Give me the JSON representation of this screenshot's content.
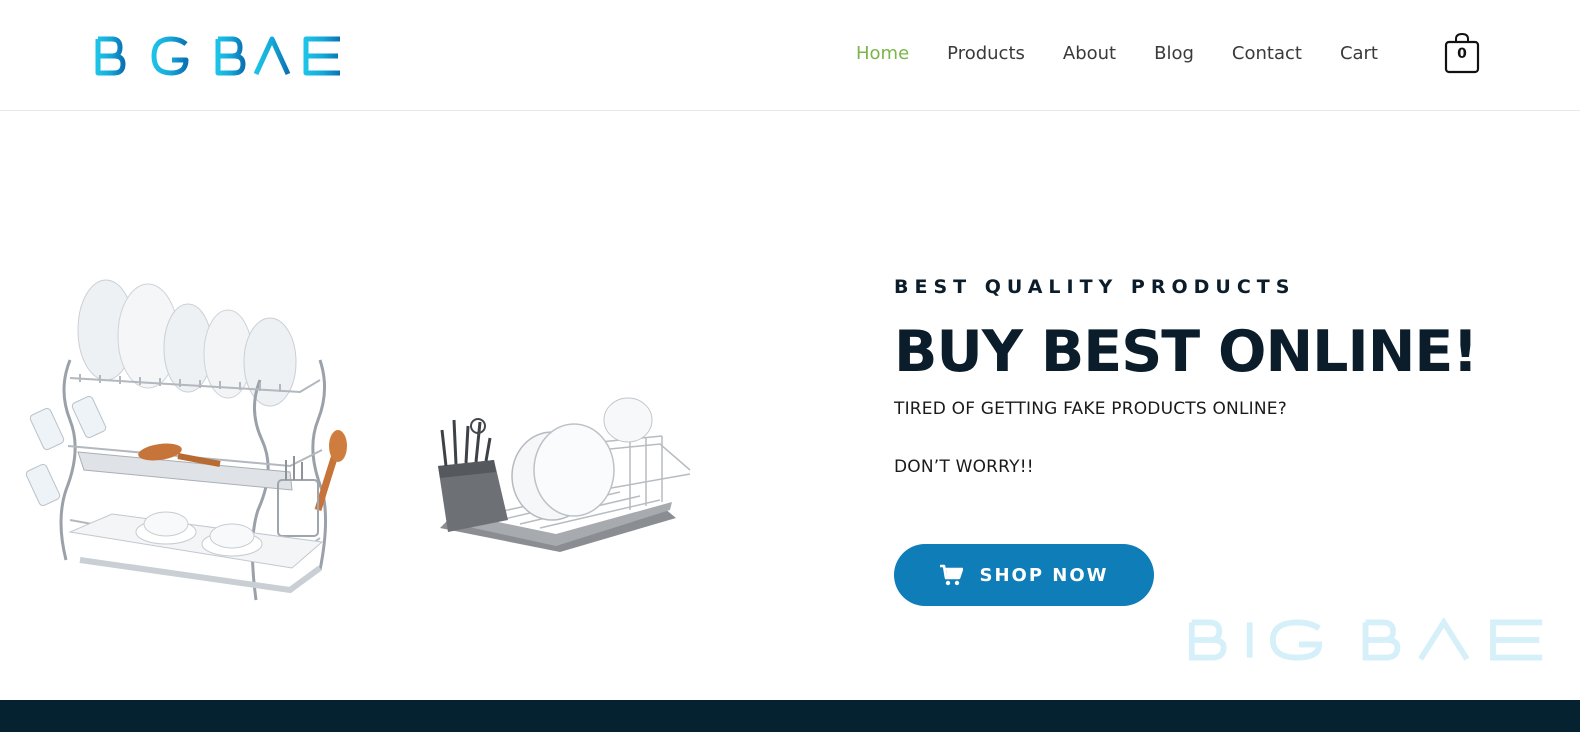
{
  "brand": {
    "logo_text": "BIGBAE",
    "color_light": "#1cb8e0",
    "color_dark": "#0b7dbb"
  },
  "nav": {
    "items": [
      {
        "label": "Home",
        "active": true
      },
      {
        "label": "Products",
        "active": false
      },
      {
        "label": "About",
        "active": false
      },
      {
        "label": "Blog",
        "active": false
      },
      {
        "label": "Contact",
        "active": false
      },
      {
        "label": "Cart",
        "active": false
      }
    ],
    "cart_count": "0"
  },
  "hero": {
    "eyebrow": "BEST QUALITY PRODUCTS",
    "headline": "BUY BEST ONLINE!",
    "subline": "TIRED OF GETTING FAKE PRODUCTS ONLINE?",
    "subline2": "DON’T WORRY!!",
    "cta_label": "SHOP NOW",
    "cta_icon": "cart-icon",
    "watermark_text": "BIGBAE"
  },
  "colors": {
    "accent": "#0e7db8",
    "nav_active": "#7ab648",
    "footer": "#052230",
    "heading": "#0b1d2a"
  }
}
